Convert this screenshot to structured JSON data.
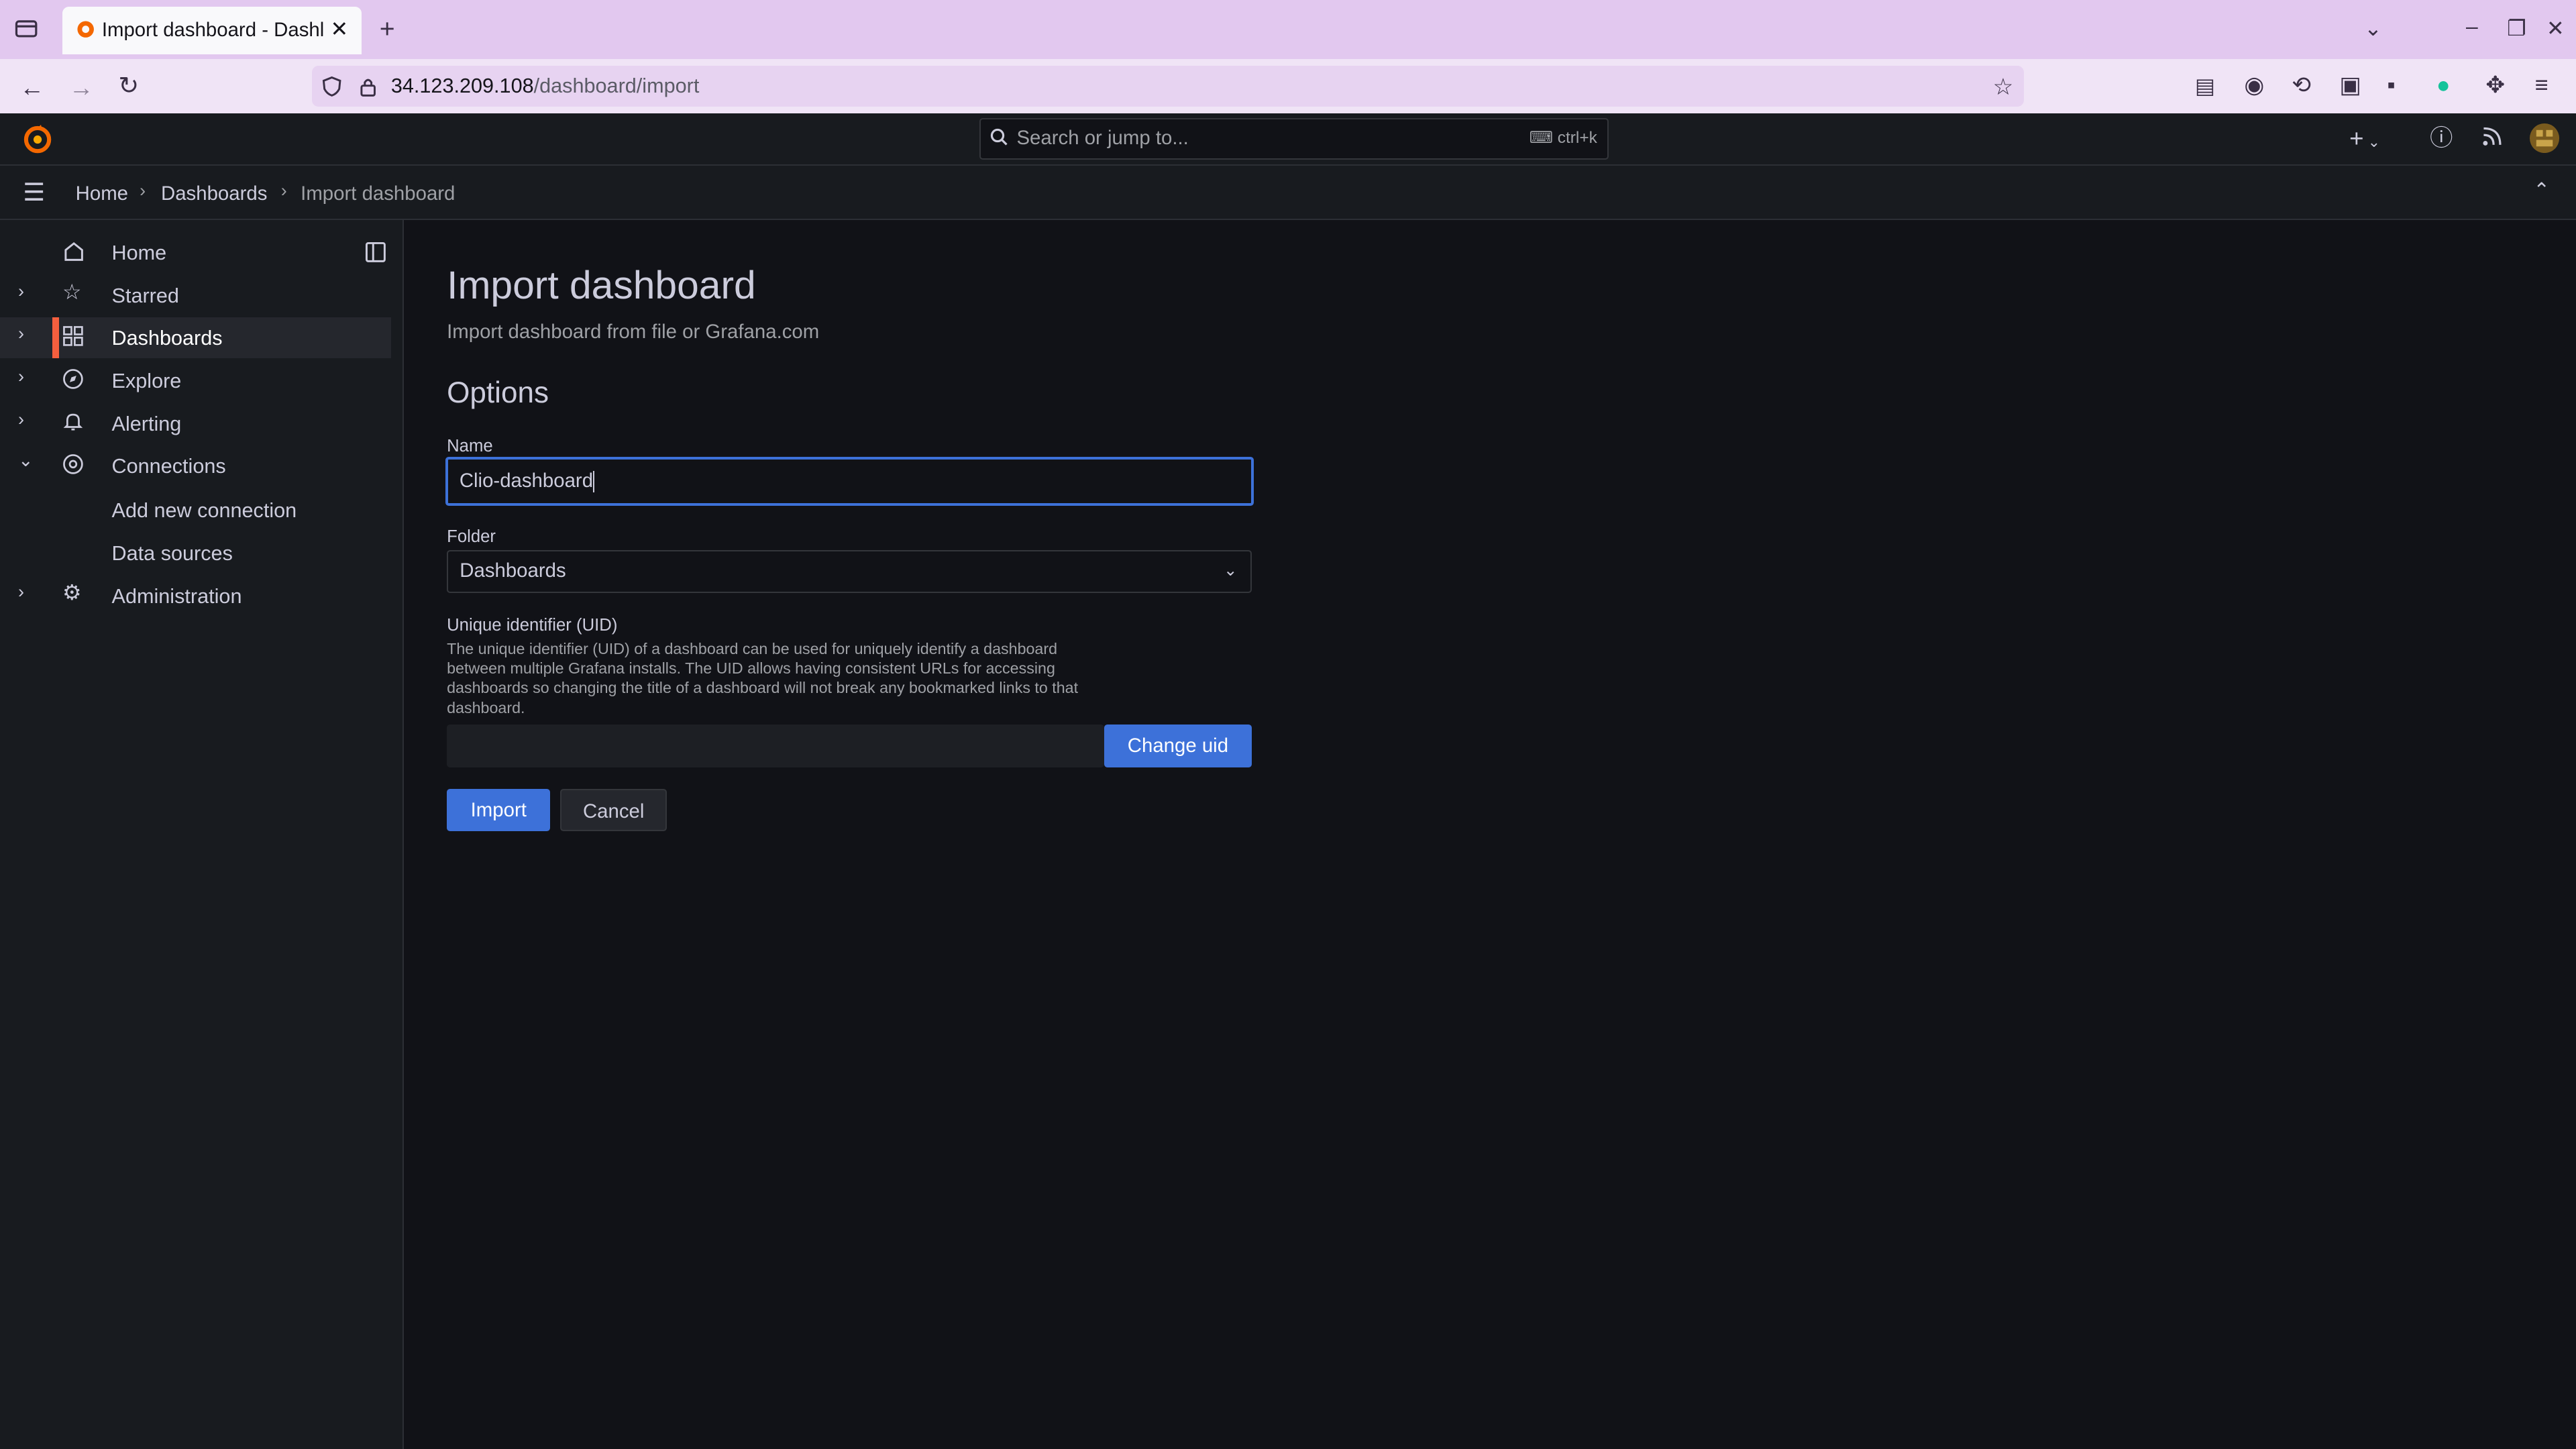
{
  "browser": {
    "tab_title": "Import dashboard - Dashl",
    "url_host": "34.123.209.108",
    "url_path": "/dashboard/import"
  },
  "topbar": {
    "search_placeholder": "Search or jump to...",
    "search_shortcut": "ctrl+k",
    "new_label": "+"
  },
  "breadcrumbs": [
    "Home",
    "Dashboards",
    "Import dashboard"
  ],
  "sidebar": {
    "items": [
      {
        "label": "Home"
      },
      {
        "label": "Starred"
      },
      {
        "label": "Dashboards"
      },
      {
        "label": "Explore"
      },
      {
        "label": "Alerting"
      },
      {
        "label": "Connections"
      },
      {
        "label": "Administration"
      }
    ],
    "sub_items": [
      "Add new connection",
      "Data sources"
    ]
  },
  "main": {
    "title": "Import dashboard",
    "subtitle": "Import dashboard from file or Grafana.com",
    "section": "Options",
    "name_label": "Name",
    "name_value": "Clio-dashboard",
    "folder_label": "Folder",
    "folder_value": "Dashboards",
    "uid_label": "Unique identifier (UID)",
    "uid_description": "The unique identifier (UID) of a dashboard can be used for uniquely identify a dashboard between multiple Grafana installs. The UID allows having consistent URLs for accessing dashboards so changing the title of a dashboard will not break any bookmarked links to that dashboard.",
    "uid_value": "",
    "change_uid_label": "Change uid",
    "import_label": "Import",
    "cancel_label": "Cancel"
  },
  "colors": {
    "accent": "#3d71d9",
    "active_nav": "#f55f3e",
    "background": "#111217"
  }
}
